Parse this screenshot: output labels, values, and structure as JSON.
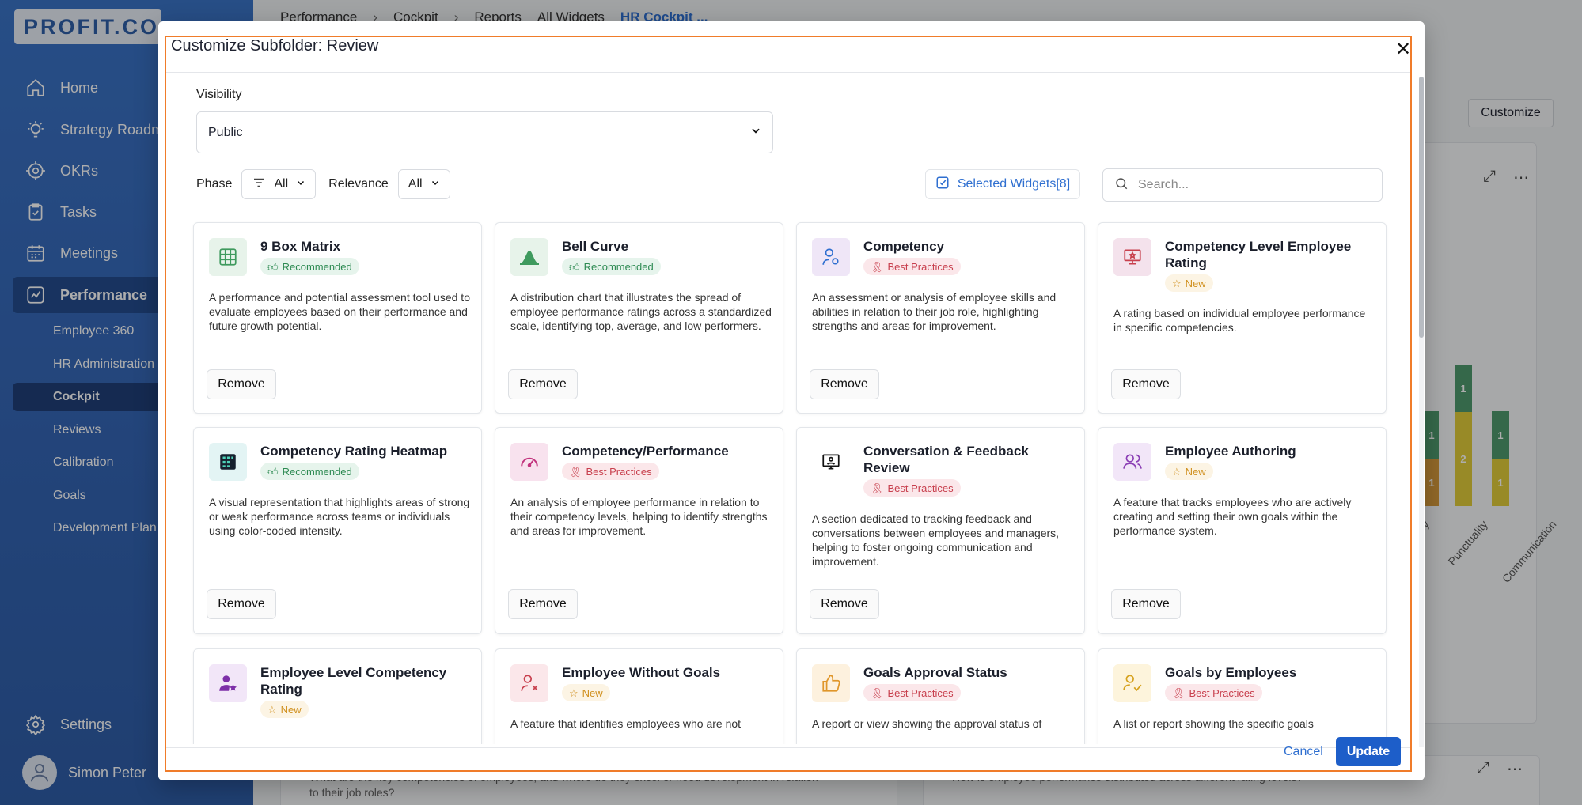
{
  "brand": {
    "logo_text": "PROFIT.CO"
  },
  "sidebar": {
    "items": [
      {
        "label": "Home",
        "icon": "home-icon"
      },
      {
        "label": "Strategy Roadmap",
        "icon": "bulb-icon"
      },
      {
        "label": "OKRs",
        "icon": "target-icon"
      },
      {
        "label": "Tasks",
        "icon": "clipboard-icon"
      },
      {
        "label": "Meetings",
        "icon": "calendar-icon"
      },
      {
        "label": "Performance",
        "icon": "chart-line-icon"
      }
    ],
    "sub_items": [
      "Employee 360",
      "HR Administration",
      "Cockpit",
      "Reviews",
      "Calibration",
      "Goals",
      "Development Plan"
    ],
    "settings_label": "Settings",
    "user_name": "Simon Peter"
  },
  "background": {
    "breadcrumb": [
      "Performance",
      "Cockpit",
      "Reports",
      "All Widgets",
      "HR Cockpit ..."
    ],
    "customize_label": "Customize",
    "question_left": "What are the key competencies of employees, and where do they excel or need development in relation to their job roles?",
    "question_right": "How is employee performance distributed across different rating levels?",
    "chart_labels": [
      "...y",
      "Punctuality",
      "Communication"
    ],
    "chart_values": {
      "col1": [
        "1",
        "1"
      ],
      "col2": [
        "1",
        "2"
      ],
      "col3": [
        "1",
        "1"
      ]
    }
  },
  "modal": {
    "title": "Customize Subfolder: Review",
    "visibility_label": "Visibility",
    "visibility_value": "Public",
    "phase_label": "Phase",
    "phase_value": "All",
    "relevance_label": "Relevance",
    "relevance_value": "All",
    "selected_widgets_label": "Selected Widgets[8]",
    "search_placeholder": "Search...",
    "remove_label": "Remove",
    "cancel_label": "Cancel",
    "update_label": "Update",
    "widgets": [
      {
        "title": "9 Box Matrix",
        "badge": "Recommended",
        "desc": "A performance and potential assessment tool used to evaluate employees based on their performance and future growth potential."
      },
      {
        "title": "Bell Curve",
        "badge": "Recommended",
        "desc": "A distribution chart that illustrates the spread of employee performance ratings across a standardized scale, identifying top, average, and low performers."
      },
      {
        "title": "Competency",
        "badge": "Best Practices",
        "desc": "An assessment or analysis of employee skills and abilities in relation to their job role, highlighting strengths and areas for improvement."
      },
      {
        "title": "Competency Level Employee Rating",
        "badge": "New",
        "desc": "A rating based on individual employee performance in specific competencies."
      },
      {
        "title": "Competency Rating Heatmap",
        "badge": "Recommended",
        "desc": "A visual representation that highlights areas of strong or weak performance across teams or individuals using color-coded intensity."
      },
      {
        "title": "Competency/Performance",
        "badge": "Best Practices",
        "desc": "An analysis of employee performance in relation to their competency levels, helping to identify strengths and areas for improvement."
      },
      {
        "title": "Conversation & Feedback Review",
        "badge": "Best Practices",
        "desc": "A section dedicated to tracking feedback and conversations between employees and managers, helping to foster ongoing communication and improvement."
      },
      {
        "title": "Employee Authoring",
        "badge": "New",
        "desc": "A feature that tracks employees who are actively creating and setting their own goals within the performance system."
      },
      {
        "title": "Employee Level Competency Rating",
        "badge": "New",
        "desc": ""
      },
      {
        "title": "Employee Without Goals",
        "badge": "New",
        "desc": "A feature that identifies employees who are not"
      },
      {
        "title": "Goals Approval Status",
        "badge": "Best Practices",
        "desc": "A report or view showing the approval status of"
      },
      {
        "title": "Goals by Employees",
        "badge": "Best Practices",
        "desc": "A list or report showing the specific goals"
      }
    ]
  },
  "colors": {
    "accent": "#1d5ec9",
    "link": "#2f6fd0",
    "frame": "#f07c2a",
    "sidebar": "#3567b7"
  }
}
